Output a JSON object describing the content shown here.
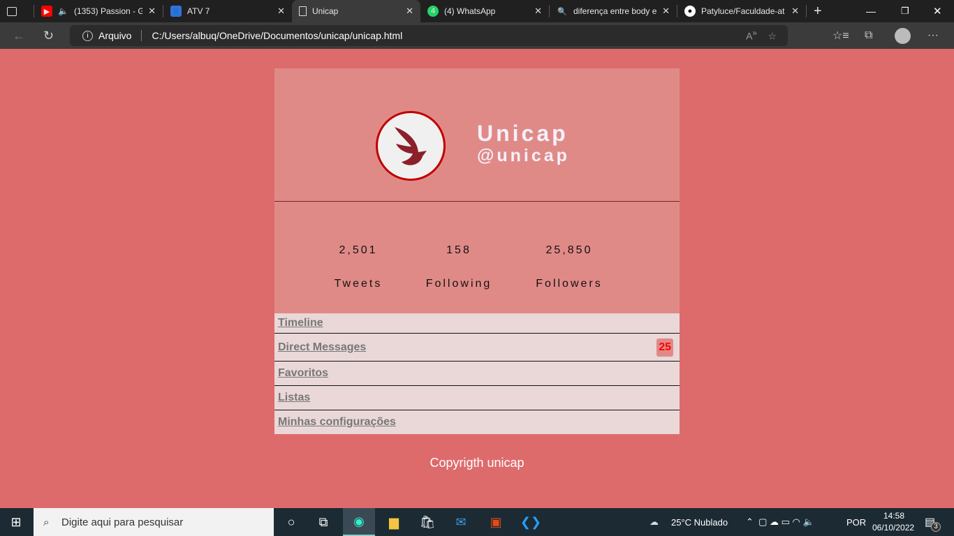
{
  "browser": {
    "tabs": [
      {
        "title": "(1353) Passion - G",
        "icon": "youtube-icon"
      },
      {
        "title": "ATV 7",
        "icon": "classroom-icon"
      },
      {
        "title": "Unicap",
        "icon": "file-icon",
        "active": true
      },
      {
        "title": "(4) WhatsApp",
        "icon": "whatsapp-icon"
      },
      {
        "title": "diferença entre body e",
        "icon": "search-icon"
      },
      {
        "title": "Patyluce/Faculdade-at",
        "icon": "github-icon"
      }
    ],
    "address_label": "Arquivo",
    "url": "C:/Users/albuq/OneDrive/Documentos/unicap/unicap.html"
  },
  "profile": {
    "name": "Unicap",
    "handle": "@unicap"
  },
  "stats": [
    {
      "value": "2,501",
      "label": "Tweets"
    },
    {
      "value": "158",
      "label": "Following"
    },
    {
      "value": "25,850",
      "label": "Followers"
    }
  ],
  "menu": [
    {
      "label": "Timeline"
    },
    {
      "label": "Direct Messages",
      "badge": "25"
    },
    {
      "label": "Favoritos"
    },
    {
      "label": "Listas"
    },
    {
      "label": "Minhas configurações"
    }
  ],
  "footer": "Copyrigth unicap",
  "taskbar": {
    "search_placeholder": "Digite aqui para pesquisar",
    "weather": "25°C  Nublado",
    "lang": "POR",
    "time": "14:58",
    "date": "06/10/2022",
    "notifications": "3"
  }
}
